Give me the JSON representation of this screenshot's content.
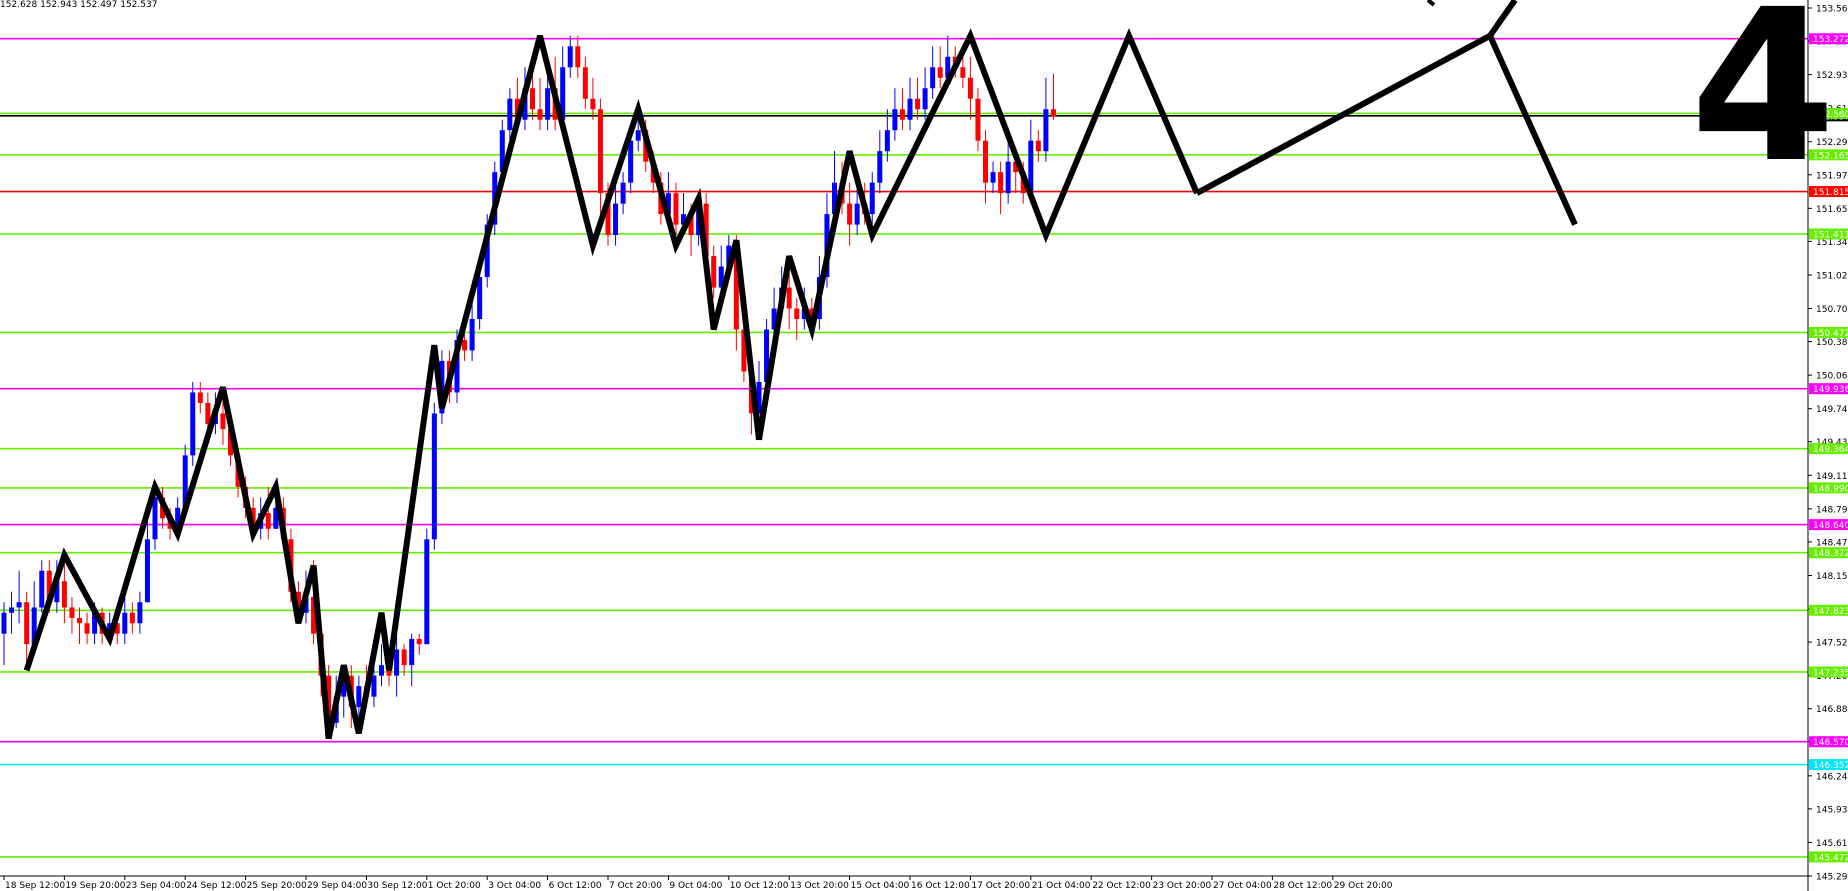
{
  "header": {
    "ohlc": "152.628 152.943 152.497 152.537"
  },
  "chart_data": {
    "type": "candlestick",
    "big_label": "4",
    "y_range": [
      145.29,
      153.565
    ],
    "y_ticks": [
      "153.565",
      "153.250",
      "152.930",
      "152.610",
      "152.290",
      "151.975",
      "151.655",
      "151.340",
      "151.020",
      "150.700",
      "150.385",
      "150.065",
      "149.745",
      "149.430",
      "149.110",
      "148.790",
      "148.475",
      "148.155",
      "147.835",
      "147.520",
      "147.200",
      "146.885",
      "146.570",
      "146.245",
      "145.930",
      "145.610",
      "145.290"
    ],
    "x_labels": [
      {
        "label": "18 Sep 12:00",
        "bar": 0
      },
      {
        "label": "19 Sep 20:00",
        "bar": 8
      },
      {
        "label": "23 Sep 04:00",
        "bar": 16
      },
      {
        "label": "24 Sep 12:00",
        "bar": 24
      },
      {
        "label": "25 Sep 20:00",
        "bar": 32
      },
      {
        "label": "29 Sep 04:00",
        "bar": 40
      },
      {
        "label": "30 Sep 12:00",
        "bar": 48
      },
      {
        "label": "1 Oct 20:00",
        "bar": 56
      },
      {
        "label": "3 Oct 04:00",
        "bar": 64
      },
      {
        "label": "6 Oct 12:00",
        "bar": 72
      },
      {
        "label": "7 Oct 20:00",
        "bar": 80
      },
      {
        "label": "9 Oct 04:00",
        "bar": 88
      },
      {
        "label": "10 Oct 12:00",
        "bar": 96
      },
      {
        "label": "13 Oct 20:00",
        "bar": 104
      },
      {
        "label": "15 Oct 04:00",
        "bar": 112
      },
      {
        "label": "16 Oct 12:00",
        "bar": 120
      },
      {
        "label": "17 Oct 20:00",
        "bar": 128
      },
      {
        "label": "21 Oct 04:00",
        "bar": 136
      },
      {
        "label": "22 Oct 12:00",
        "bar": 144
      },
      {
        "label": "23 Oct 20:00",
        "bar": 152
      },
      {
        "label": "27 Oct 04:00",
        "bar": 160
      },
      {
        "label": "28 Oct 12:00",
        "bar": 168
      },
      {
        "label": "29 Oct 20:00",
        "bar": 176
      }
    ],
    "levels": [
      {
        "price": 153.272,
        "label": "153.272",
        "color": "#ff00ff"
      },
      {
        "price": 152.537,
        "label": "152.537",
        "color": "#000000"
      },
      {
        "price": 152.56,
        "label": "152.560",
        "color": "#66ee00"
      },
      {
        "price": 152.165,
        "label": "152.165",
        "color": "#66ee00"
      },
      {
        "price": 151.815,
        "label": "151.815",
        "color": "#ff0000"
      },
      {
        "price": 151.411,
        "label": "151.411",
        "color": "#66ee00"
      },
      {
        "price": 150.472,
        "label": "150.472",
        "color": "#66ee00"
      },
      {
        "price": 149.936,
        "label": "149.936",
        "color": "#ff00ff"
      },
      {
        "price": 149.364,
        "label": "149.364",
        "color": "#66ee00"
      },
      {
        "price": 148.99,
        "label": "148.990",
        "color": "#66ee00"
      },
      {
        "price": 148.64,
        "label": "148.640",
        "color": "#ff00ff"
      },
      {
        "price": 148.372,
        "label": "148.372",
        "color": "#66ee00"
      },
      {
        "price": 147.823,
        "label": "147.823",
        "color": "#66ee00"
      },
      {
        "price": 147.235,
        "label": "147.235",
        "color": "#66ee00"
      },
      {
        "price": 146.57,
        "label": "146.570",
        "color": "#ff00ff"
      },
      {
        "price": 146.352,
        "label": "146.352",
        "color": "#00e5ff"
      },
      {
        "price": 145.472,
        "label": "145.472",
        "color": "#66ee00"
      }
    ],
    "zigzag_bars": [
      [
        3,
        147.25
      ],
      [
        8,
        148.35
      ],
      [
        14,
        147.55
      ],
      [
        20,
        149.0
      ],
      [
        23,
        148.55
      ],
      [
        29,
        149.95
      ],
      [
        33,
        148.55
      ],
      [
        36,
        149.0
      ],
      [
        39,
        147.7
      ],
      [
        41,
        148.25
      ],
      [
        43,
        146.6
      ],
      [
        45,
        147.3
      ],
      [
        47,
        146.65
      ],
      [
        50,
        147.8
      ],
      [
        51,
        147.25
      ],
      [
        57,
        150.35
      ],
      [
        58,
        149.75
      ],
      [
        71,
        153.3
      ],
      [
        78,
        151.3
      ],
      [
        84,
        152.6
      ],
      [
        89,
        151.3
      ],
      [
        92,
        151.75
      ],
      [
        94,
        150.5
      ],
      [
        97,
        151.35
      ],
      [
        100,
        149.45
      ],
      [
        104,
        151.2
      ],
      [
        107,
        150.5
      ],
      [
        112,
        152.2
      ],
      [
        115,
        151.4
      ],
      [
        128,
        153.3
      ],
      [
        138,
        151.4
      ],
      [
        149,
        153.3
      ],
      [
        158,
        151.8
      ]
    ],
    "zigzag_extra": [
      [
        1275,
        0
      ],
      [
        1288,
        -8
      ],
      [
        1255,
        45
      ],
      [
        1283,
        0
      ]
    ],
    "candles": [
      [
        0,
        147.6,
        147.8,
        147.9,
        147.3
      ],
      [
        1,
        147.8,
        147.85,
        148.0,
        147.6
      ],
      [
        2,
        147.85,
        147.9,
        148.2,
        147.7
      ],
      [
        3,
        147.9,
        147.5,
        148.0,
        147.3
      ],
      [
        4,
        147.5,
        147.85,
        148.1,
        147.4
      ],
      [
        5,
        147.85,
        148.2,
        148.3,
        147.8
      ],
      [
        6,
        148.2,
        147.9,
        148.3,
        147.8
      ],
      [
        7,
        147.9,
        148.1,
        148.3,
        147.8
      ],
      [
        8,
        148.1,
        147.85,
        148.3,
        147.7
      ],
      [
        9,
        147.85,
        147.75,
        147.95,
        147.6
      ],
      [
        10,
        147.75,
        147.7,
        147.85,
        147.5
      ],
      [
        11,
        147.7,
        147.6,
        147.8,
        147.5
      ],
      [
        12,
        147.6,
        147.8,
        147.9,
        147.5
      ],
      [
        13,
        147.8,
        147.6,
        147.85,
        147.5
      ],
      [
        14,
        147.6,
        147.7,
        147.8,
        147.5
      ],
      [
        15,
        147.7,
        147.6,
        147.8,
        147.5
      ],
      [
        16,
        147.6,
        147.8,
        147.95,
        147.5
      ],
      [
        17,
        147.8,
        147.7,
        147.9,
        147.6
      ],
      [
        18,
        147.7,
        147.9,
        148.0,
        147.6
      ],
      [
        19,
        147.9,
        148.5,
        148.7,
        147.9
      ],
      [
        20,
        148.5,
        148.9,
        149.0,
        148.4
      ],
      [
        21,
        148.9,
        148.7,
        149.0,
        148.6
      ],
      [
        22,
        148.7,
        148.6,
        148.8,
        148.5
      ],
      [
        23,
        148.6,
        148.8,
        148.9,
        148.5
      ],
      [
        24,
        148.8,
        149.3,
        149.4,
        148.7
      ],
      [
        25,
        149.3,
        149.9,
        150.0,
        149.2
      ],
      [
        26,
        149.9,
        149.8,
        150.0,
        149.7
      ],
      [
        27,
        149.8,
        149.6,
        149.9,
        149.5
      ],
      [
        28,
        149.6,
        149.7,
        149.9,
        149.5
      ],
      [
        29,
        149.7,
        149.55,
        149.95,
        149.4
      ],
      [
        30,
        149.55,
        149.3,
        149.6,
        149.2
      ],
      [
        31,
        149.3,
        149.0,
        149.3,
        148.9
      ],
      [
        32,
        149.0,
        148.8,
        149.1,
        148.7
      ],
      [
        33,
        148.8,
        148.6,
        148.9,
        148.5
      ],
      [
        34,
        148.6,
        148.75,
        148.9,
        148.5
      ],
      [
        35,
        148.75,
        148.6,
        149.0,
        148.5
      ],
      [
        36,
        148.6,
        148.8,
        149.0,
        148.6
      ],
      [
        37,
        148.8,
        148.5,
        148.9,
        148.4
      ],
      [
        38,
        148.5,
        148.0,
        148.6,
        147.9
      ],
      [
        39,
        148.0,
        147.8,
        148.1,
        147.7
      ],
      [
        40,
        147.8,
        147.95,
        148.2,
        147.7
      ],
      [
        41,
        147.95,
        147.6,
        148.3,
        147.5
      ],
      [
        42,
        147.6,
        147.2,
        147.7,
        147.0
      ],
      [
        43,
        147.2,
        146.75,
        147.3,
        146.6
      ],
      [
        44,
        146.75,
        147.0,
        147.2,
        146.7
      ],
      [
        45,
        147.0,
        147.2,
        147.3,
        146.8
      ],
      [
        46,
        147.2,
        146.9,
        147.3,
        146.7
      ],
      [
        47,
        146.9,
        147.1,
        147.2,
        146.65
      ],
      [
        48,
        147.1,
        147.0,
        147.3,
        146.9
      ],
      [
        49,
        147.0,
        147.2,
        147.4,
        146.9
      ],
      [
        50,
        147.2,
        147.3,
        147.5,
        147.1
      ],
      [
        51,
        147.3,
        147.2,
        147.4,
        147.1
      ],
      [
        52,
        147.2,
        147.45,
        147.6,
        147.0
      ],
      [
        53,
        147.45,
        147.3,
        147.5,
        147.2
      ],
      [
        54,
        147.3,
        147.55,
        147.6,
        147.1
      ],
      [
        55,
        147.55,
        147.5,
        147.6,
        147.4
      ],
      [
        56,
        147.5,
        148.5,
        148.6,
        147.5
      ],
      [
        57,
        148.5,
        149.7,
        149.8,
        148.4
      ],
      [
        58,
        149.7,
        150.2,
        150.3,
        149.6
      ],
      [
        59,
        150.2,
        149.9,
        150.3,
        149.8
      ],
      [
        60,
        149.9,
        150.4,
        150.5,
        149.8
      ],
      [
        61,
        150.4,
        150.3,
        150.5,
        150.2
      ],
      [
        62,
        150.3,
        150.6,
        150.8,
        150.2
      ],
      [
        63,
        150.6,
        151.0,
        151.2,
        150.5
      ],
      [
        64,
        151.0,
        151.5,
        151.6,
        150.9
      ],
      [
        65,
        151.5,
        152.0,
        152.1,
        151.4
      ],
      [
        66,
        152.0,
        152.4,
        152.5,
        151.9
      ],
      [
        67,
        152.4,
        152.7,
        152.8,
        152.3
      ],
      [
        68,
        152.7,
        152.5,
        152.9,
        152.4
      ],
      [
        69,
        152.5,
        152.8,
        153.0,
        152.4
      ],
      [
        70,
        152.8,
        152.6,
        153.0,
        152.5
      ],
      [
        71,
        152.6,
        152.5,
        152.9,
        152.4
      ],
      [
        72,
        152.5,
        152.8,
        153.0,
        152.4
      ],
      [
        73,
        152.8,
        152.5,
        153.1,
        152.4
      ],
      [
        74,
        152.5,
        153.0,
        153.2,
        152.4
      ],
      [
        75,
        153.0,
        153.2,
        153.3,
        152.9
      ],
      [
        76,
        153.2,
        153.0,
        153.3,
        152.9
      ],
      [
        77,
        153.0,
        152.7,
        153.1,
        152.6
      ],
      [
        78,
        152.7,
        152.6,
        152.9,
        152.5
      ],
      [
        79,
        152.6,
        151.8,
        152.7,
        151.6
      ],
      [
        80,
        151.8,
        151.4,
        151.9,
        151.3
      ],
      [
        81,
        151.4,
        151.7,
        151.9,
        151.3
      ],
      [
        82,
        151.7,
        151.9,
        152.0,
        151.6
      ],
      [
        83,
        151.9,
        152.3,
        152.4,
        151.8
      ],
      [
        84,
        152.3,
        152.4,
        152.6,
        152.2
      ],
      [
        85,
        152.4,
        152.1,
        152.5,
        152.0
      ],
      [
        86,
        152.1,
        151.9,
        152.2,
        151.8
      ],
      [
        87,
        151.9,
        151.6,
        152.0,
        151.5
      ],
      [
        88,
        151.6,
        151.8,
        152.0,
        151.5
      ],
      [
        89,
        151.8,
        151.5,
        151.9,
        151.4
      ],
      [
        90,
        151.5,
        151.6,
        151.8,
        151.4
      ],
      [
        91,
        151.6,
        151.4,
        151.7,
        151.2
      ],
      [
        92,
        151.4,
        151.7,
        151.8,
        151.3
      ],
      [
        93,
        151.7,
        151.2,
        151.8,
        151.1
      ],
      [
        94,
        151.2,
        150.9,
        151.3,
        150.8
      ],
      [
        95,
        150.9,
        151.1,
        151.3,
        150.8
      ],
      [
        96,
        151.1,
        151.3,
        151.4,
        151.0
      ],
      [
        97,
        151.3,
        150.5,
        151.4,
        150.3
      ],
      [
        98,
        150.5,
        150.1,
        150.6,
        150.0
      ],
      [
        99,
        150.1,
        149.7,
        150.2,
        149.5
      ],
      [
        100,
        149.7,
        150.0,
        150.2,
        149.45
      ],
      [
        101,
        150.0,
        150.5,
        150.6,
        149.9
      ],
      [
        102,
        150.5,
        150.7,
        150.9,
        150.3
      ],
      [
        103,
        150.7,
        150.9,
        151.1,
        150.6
      ],
      [
        104,
        150.9,
        150.7,
        151.1,
        150.5
      ],
      [
        105,
        150.7,
        150.6,
        150.8,
        150.4
      ],
      [
        106,
        150.6,
        150.7,
        150.9,
        150.5
      ],
      [
        107,
        150.7,
        150.6,
        150.8,
        150.5
      ],
      [
        108,
        150.6,
        151.0,
        151.2,
        150.5
      ],
      [
        109,
        151.0,
        151.6,
        151.8,
        150.9
      ],
      [
        110,
        151.6,
        151.9,
        152.2,
        151.5
      ],
      [
        111,
        151.9,
        151.7,
        152.1,
        151.6
      ],
      [
        112,
        151.7,
        151.5,
        151.9,
        151.3
      ],
      [
        113,
        151.5,
        151.7,
        151.9,
        151.4
      ],
      [
        114,
        151.7,
        151.6,
        151.9,
        151.5
      ],
      [
        115,
        151.6,
        151.9,
        152.0,
        151.5
      ],
      [
        116,
        151.9,
        152.2,
        152.4,
        151.8
      ],
      [
        117,
        152.2,
        152.4,
        152.6,
        152.1
      ],
      [
        118,
        152.4,
        152.6,
        152.8,
        152.3
      ],
      [
        119,
        152.6,
        152.5,
        152.8,
        152.4
      ],
      [
        120,
        152.5,
        152.7,
        152.9,
        152.4
      ],
      [
        121,
        152.7,
        152.6,
        152.9,
        152.5
      ],
      [
        122,
        152.6,
        152.8,
        153.0,
        152.5
      ],
      [
        123,
        152.8,
        153.0,
        153.2,
        152.7
      ],
      [
        124,
        153.0,
        152.9,
        153.2,
        152.8
      ],
      [
        125,
        152.9,
        153.1,
        153.3,
        152.8
      ],
      [
        126,
        153.1,
        153.0,
        153.2,
        152.9
      ],
      [
        127,
        153.0,
        152.9,
        153.2,
        152.8
      ],
      [
        128,
        152.9,
        152.7,
        153.1,
        152.5
      ],
      [
        129,
        152.7,
        152.3,
        152.8,
        152.2
      ],
      [
        130,
        152.3,
        151.9,
        152.4,
        151.7
      ],
      [
        131,
        151.9,
        152.0,
        152.1,
        151.8
      ],
      [
        132,
        152.0,
        151.8,
        152.1,
        151.6
      ],
      [
        133,
        151.8,
        152.1,
        152.3,
        151.7
      ],
      [
        134,
        152.1,
        152.0,
        152.2,
        151.8
      ],
      [
        135,
        152.0,
        151.8,
        152.1,
        151.7
      ],
      [
        136,
        151.8,
        152.3,
        152.5,
        151.7
      ],
      [
        137,
        152.3,
        152.2,
        152.4,
        152.1
      ],
      [
        138,
        152.2,
        152.6,
        152.9,
        152.1
      ],
      [
        139,
        152.6,
        152.53,
        152.94,
        152.5
      ]
    ]
  }
}
